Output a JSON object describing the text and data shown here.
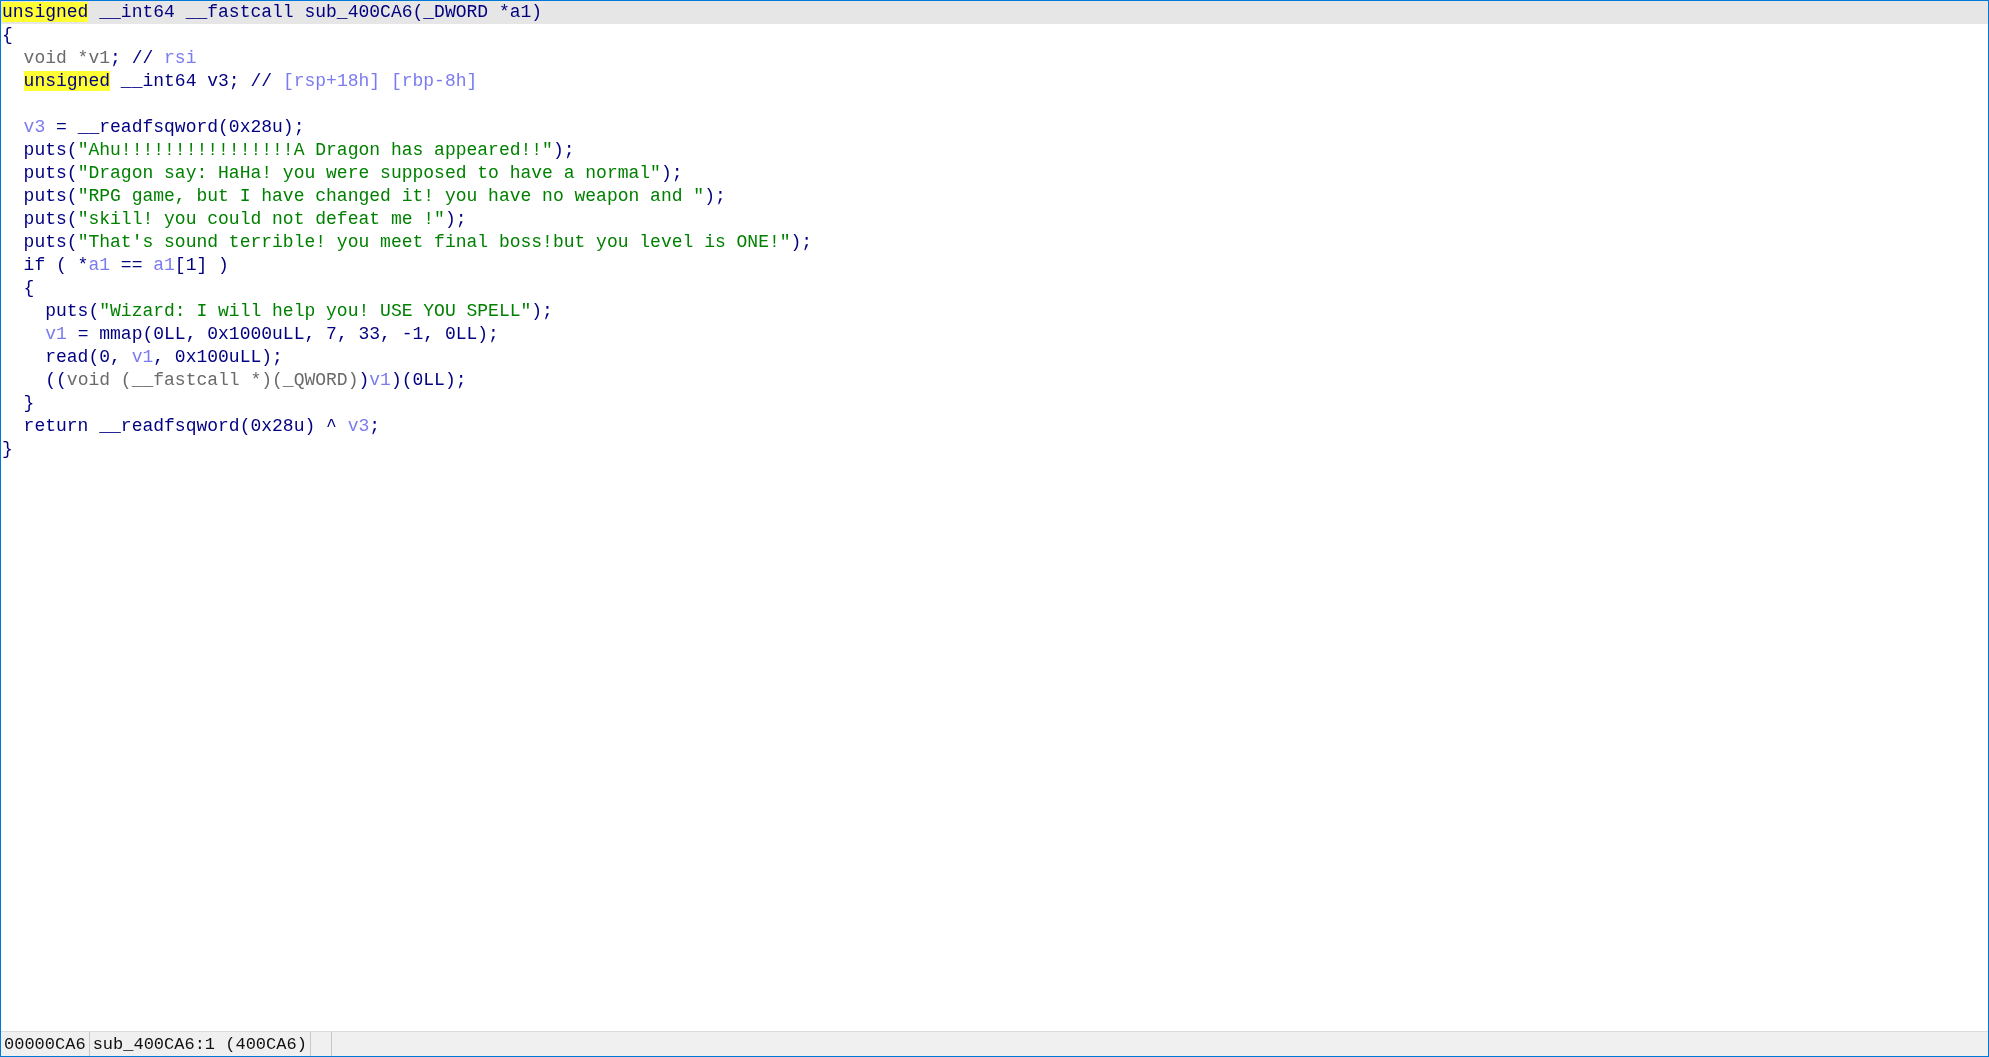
{
  "code_view": {
    "lines": [
      {
        "current": true,
        "tokens": [
          {
            "kind": "match",
            "text": "unsigned"
          },
          {
            "kind": "code",
            "text": " __int64 __fastcall sub_400CA6(_DWORD *a1)"
          }
        ]
      },
      {
        "current": false,
        "tokens": [
          {
            "kind": "code",
            "text": "{"
          }
        ]
      },
      {
        "current": false,
        "tokens": [
          {
            "kind": "decl",
            "text": "  void *v1"
          },
          {
            "kind": "code",
            "text": "; // "
          },
          {
            "kind": "comment",
            "text": "rsi"
          }
        ]
      },
      {
        "current": false,
        "tokens": [
          {
            "kind": "match",
            "text": "  unsigned"
          },
          {
            "kind": "code",
            "text": " __int64 v3; // "
          },
          {
            "kind": "comment",
            "text": "[rsp+18h] [rbp-8h]"
          }
        ]
      },
      {
        "current": false
      },
      {
        "current": false,
        "tokens": [
          {
            "kind": "var",
            "text": "  v3"
          },
          {
            "kind": "code",
            "text": " = __readfsqword(0x28u);"
          }
        ]
      },
      {
        "current": false,
        "tokens": [
          {
            "kind": "code",
            "text": "  puts("
          },
          {
            "kind": "string",
            "text": "\"Ahu!!!!!!!!!!!!!!!!A Dragon has appeared!!\""
          },
          {
            "kind": "code",
            "text": ");"
          }
        ]
      },
      {
        "current": false,
        "tokens": [
          {
            "kind": "code",
            "text": "  puts("
          },
          {
            "kind": "string",
            "text": "\"Dragon say: HaHa! you were supposed to have a normal\""
          },
          {
            "kind": "code",
            "text": ");"
          }
        ]
      },
      {
        "current": false,
        "tokens": [
          {
            "kind": "code",
            "text": "  puts("
          },
          {
            "kind": "string",
            "text": "\"RPG game, but I have changed it! you have no weapon and \""
          },
          {
            "kind": "code",
            "text": ");"
          }
        ]
      },
      {
        "current": false,
        "tokens": [
          {
            "kind": "code",
            "text": "  puts("
          },
          {
            "kind": "string",
            "text": "\"skill! you could not defeat me !\""
          },
          {
            "kind": "code",
            "text": ");"
          }
        ]
      },
      {
        "current": false,
        "tokens": [
          {
            "kind": "code",
            "text": "  puts("
          },
          {
            "kind": "string",
            "text": "\"That's sound terrible! you meet final boss!but you level is ONE!\""
          },
          {
            "kind": "code",
            "text": ");"
          }
        ]
      },
      {
        "current": false,
        "tokens": [
          {
            "kind": "code",
            "text": "  if ( *"
          },
          {
            "kind": "var",
            "text": "a1"
          },
          {
            "kind": "code",
            "text": " == "
          },
          {
            "kind": "var",
            "text": "a1"
          },
          {
            "kind": "code",
            "text": "[1] )"
          }
        ]
      },
      {
        "current": false,
        "tokens": [
          {
            "kind": "code",
            "text": "  {"
          }
        ]
      },
      {
        "current": false,
        "tokens": [
          {
            "kind": "code",
            "text": "    puts("
          },
          {
            "kind": "string",
            "text": "\"Wizard: I will help you! USE YOU SPELL\""
          },
          {
            "kind": "code",
            "text": ");"
          }
        ]
      },
      {
        "current": false,
        "tokens": [
          {
            "kind": "var",
            "text": "    v1"
          },
          {
            "kind": "code",
            "text": " = mmap(0LL, 0x1000uLL, 7, 33, -1, 0LL);"
          }
        ]
      },
      {
        "current": false,
        "tokens": [
          {
            "kind": "code",
            "text": "    read(0, "
          },
          {
            "kind": "var",
            "text": "v1"
          },
          {
            "kind": "code",
            "text": ", 0x100uLL);"
          }
        ]
      },
      {
        "current": false,
        "tokens": [
          {
            "kind": "code",
            "text": "    (("
          },
          {
            "kind": "decl",
            "text": "void (__fastcall *)(_QWORD)"
          },
          {
            "kind": "code",
            "text": ")"
          },
          {
            "kind": "var",
            "text": "v1"
          },
          {
            "kind": "code",
            "text": ")(0LL);"
          }
        ]
      },
      {
        "current": false,
        "tokens": [
          {
            "kind": "code",
            "text": "  }"
          }
        ]
      },
      {
        "current": false,
        "tokens": [
          {
            "kind": "code",
            "text": "  return __readfsqword(0x28u) ^ "
          },
          {
            "kind": "var",
            "text": "v3"
          },
          {
            "kind": "code",
            "text": ";"
          }
        ]
      },
      {
        "current": false,
        "tokens": [
          {
            "kind": "code",
            "text": "}"
          }
        ]
      }
    ]
  },
  "status_bar": {
    "segments": [
      "00000CA6",
      "sub_400CA6:1 (400CA6)"
    ]
  }
}
